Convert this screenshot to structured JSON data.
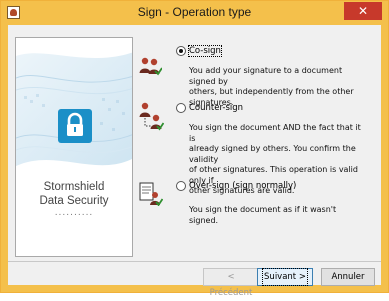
{
  "window": {
    "title": "Sign - Operation type",
    "close_glyph": "✕"
  },
  "banner": {
    "brand_line1": "Stormshield",
    "brand_line2": "Data Security",
    "dots": "..........",
    "icon": "padlock-icon",
    "accent": "#1b8fc7"
  },
  "options": [
    {
      "label": "Co-sign",
      "checked": true,
      "icon": "two-signers-icon",
      "description_lines": [
        "You add your signature to a document signed by",
        "others, but independently from the other",
        "signatures."
      ]
    },
    {
      "label": "Counter-sign",
      "checked": false,
      "icon": "counter-signers-icon",
      "description_lines": [
        "You sign the document AND the fact that it is",
        "already signed by others. You confirm the validity",
        "of other signatures. This operation is valid only if",
        "other signatures are valid."
      ]
    },
    {
      "label": "Over-sign (sign normally)",
      "checked": false,
      "icon": "document-signer-icon",
      "description_lines": [
        "You sign the document as if it wasn't signed."
      ]
    }
  ],
  "buttons": {
    "previous": "< Précédent",
    "next": "Suivant >",
    "cancel": "Annuler"
  }
}
